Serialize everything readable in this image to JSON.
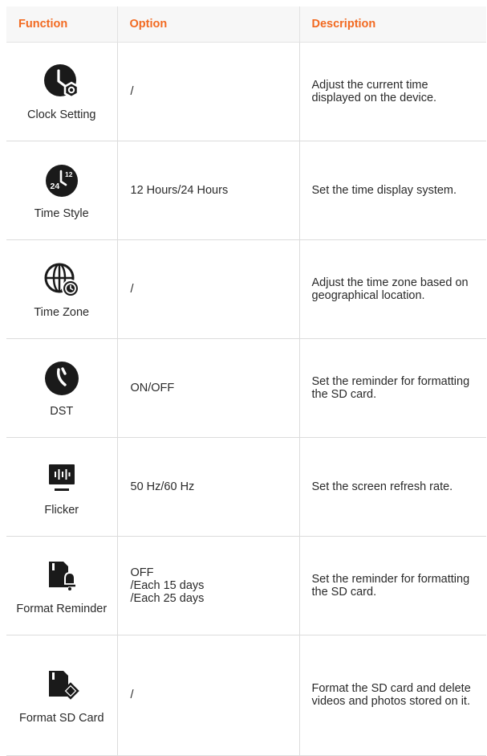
{
  "headers": {
    "function": "Function",
    "option": "Option",
    "description": "Description"
  },
  "rows": [
    {
      "icon": "clock-settings-icon",
      "label": "Clock Setting",
      "options": [
        "/"
      ],
      "description": "Adjust the current time displayed on the device."
    },
    {
      "icon": "time-style-12-24-icon",
      "label": "Time Style",
      "options": [
        "12 Hours/24 Hours"
      ],
      "description": "Set the time display system.",
      "icon_text_a": "24",
      "icon_text_b": "12"
    },
    {
      "icon": "globe-clock-icon",
      "label": "Time Zone",
      "options": [
        "/"
      ],
      "description": "Adjust the time zone based on geographical location."
    },
    {
      "icon": "dst-clock-icon",
      "label": "DST",
      "options": [
        "ON/OFF"
      ],
      "description": "Set the reminder for formatting the SD card."
    },
    {
      "icon": "flicker-monitor-icon",
      "label": "Flicker",
      "options": [
        "50 Hz/60 Hz"
      ],
      "description": "Set the screen refresh rate."
    },
    {
      "icon": "sd-card-bell-icon",
      "label": "Format Reminder",
      "options": [
        "OFF",
        "/Each 15 days",
        "/Each 25 days"
      ],
      "description": "Set the reminder for formatting the SD card."
    },
    {
      "icon": "sd-card-eraser-icon",
      "label": "Format SD Card",
      "options": [
        "/"
      ],
      "description": "Format the SD card and delete videos and photos stored on it."
    }
  ],
  "colors": {
    "header_text": "#f26a21",
    "header_bg": "#f7f7f7",
    "icon": "#1a1a1a"
  }
}
